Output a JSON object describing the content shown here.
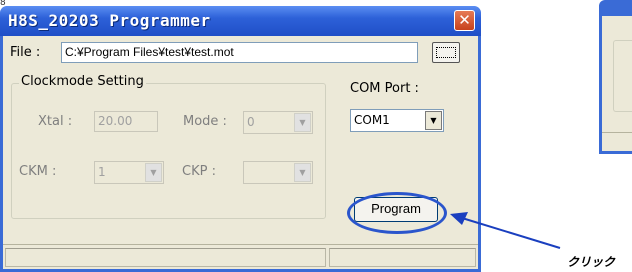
{
  "top_text": "8",
  "window": {
    "title": "H8S_20203 Programmer",
    "close_glyph": "✕"
  },
  "file": {
    "label": "File :",
    "value": "C:¥Program Files¥test¥test.mot",
    "browse_label": "...."
  },
  "clockmode": {
    "group_label": "Clockmode Setting",
    "xtal_label": "Xtal :",
    "xtal_value": "20.00",
    "mode_label": "Mode :",
    "mode_value": "0",
    "ckm_label": "CKM :",
    "ckm_value": "1",
    "ckp_label": "CKP :",
    "ckp_value": ""
  },
  "com": {
    "label": "COM Port :",
    "value": "COM1"
  },
  "program_button": "Program",
  "annotation": "クリック",
  "colors": {
    "title_bar": "#2d61d8",
    "client": "#ece9d8",
    "highlight": "#2a55cc",
    "close": "#d9532c"
  },
  "icons": {
    "close": "close-icon",
    "dropdown": "chevron-down-icon",
    "browse": "ellipsis-icon"
  }
}
